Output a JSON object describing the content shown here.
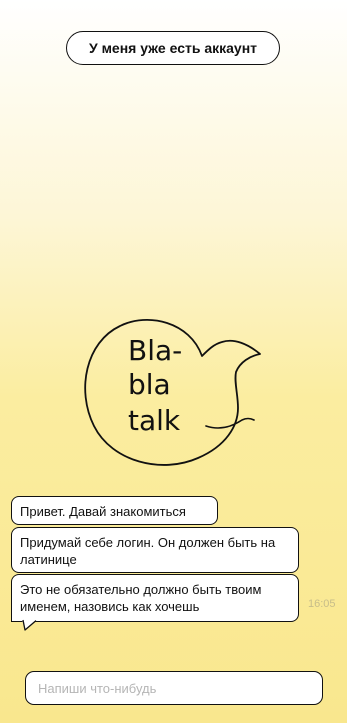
{
  "header": {
    "login_button_label": "У меня уже есть аккаунт"
  },
  "logo": {
    "line1": "Bla-",
    "line2": "bla",
    "line3": "talk",
    "icon": "speech-bubble-logo"
  },
  "chat": {
    "messages": [
      {
        "text": "Привет. Давай знакомиться"
      },
      {
        "text": "Придумай себе логин. Он должен быть на латинице"
      },
      {
        "text": "Это не обязательно должно быть твоим именем, назовись как хочешь"
      }
    ],
    "timestamp": "16:05"
  },
  "composer": {
    "placeholder": "Напиши что-нибудь",
    "value": ""
  },
  "colors": {
    "background_top": "#ffffff",
    "background_bottom": "#f9e78e",
    "outline": "#111111",
    "timestamp": "#c7bd8a"
  }
}
